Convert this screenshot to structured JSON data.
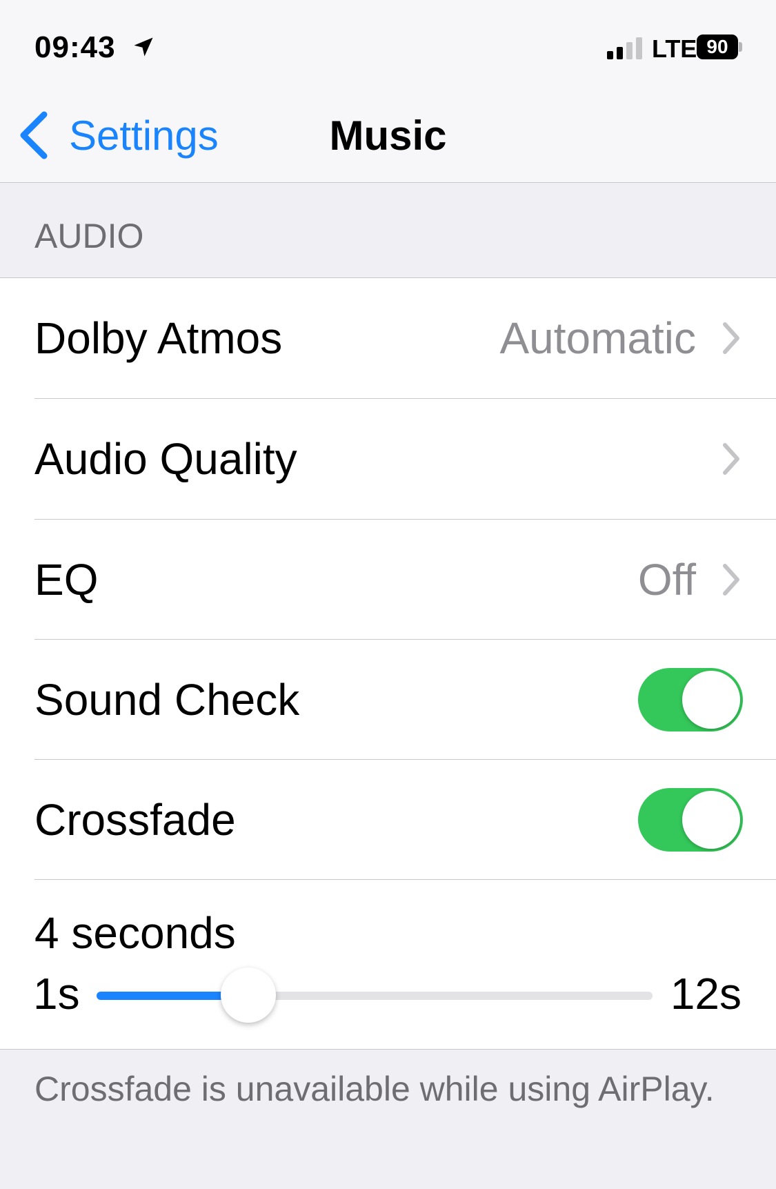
{
  "status_bar": {
    "time": "09:43",
    "network": "LTE",
    "battery": "90"
  },
  "nav": {
    "back_label": "Settings",
    "title": "Music"
  },
  "section": {
    "header": "AUDIO"
  },
  "rows": {
    "dolby": {
      "label": "Dolby Atmos",
      "value": "Automatic"
    },
    "audio_quality": {
      "label": "Audio Quality"
    },
    "eq": {
      "label": "EQ",
      "value": "Off"
    },
    "sound_check": {
      "label": "Sound Check",
      "enabled": true
    },
    "crossfade": {
      "label": "Crossfade",
      "enabled": true
    }
  },
  "crossfade_slider": {
    "value_label": "4 seconds",
    "min_label": "1s",
    "max_label": "12s",
    "min": 1,
    "max": 12,
    "value": 4
  },
  "footer": {
    "note": "Crossfade is unavailable while using AirPlay."
  },
  "colors": {
    "accent": "#1a84ff",
    "toggle_on": "#34c759",
    "secondary_text": "#8e8e93"
  }
}
